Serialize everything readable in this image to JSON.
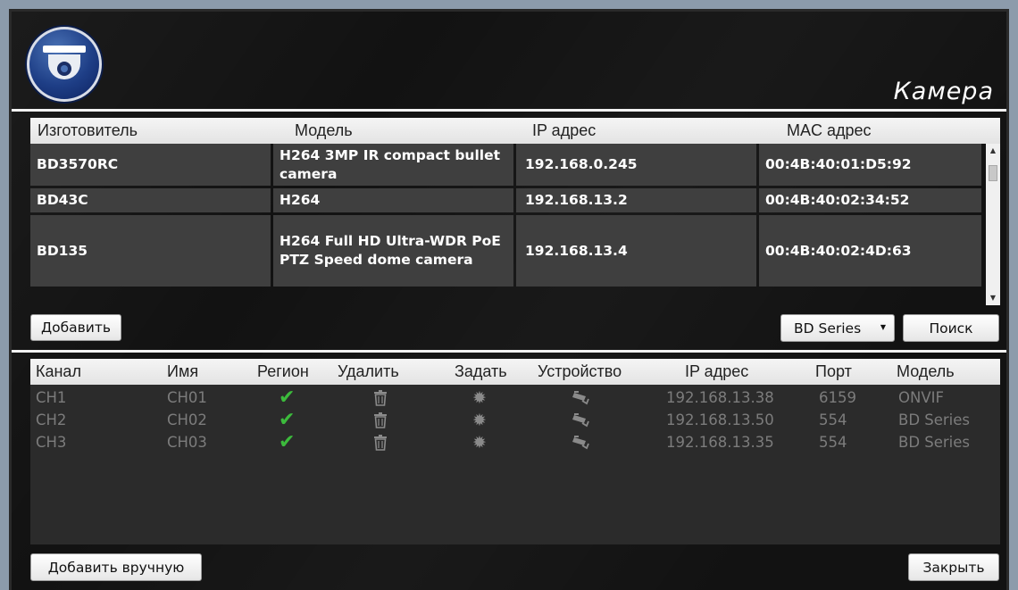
{
  "header": {
    "title": "Камера",
    "logo_icon": "dome-camera-icon"
  },
  "device_table": {
    "columns": [
      "Изготовитель",
      "Модель",
      "IP адрес",
      "MAC адрес"
    ],
    "rows": [
      {
        "vendor": "BD3570RC",
        "model": "H264 3MP IR compact bullet camera",
        "ip": "192.168.0.245",
        "mac": "00:4B:40:01:D5:92"
      },
      {
        "vendor": "BD43C",
        "model": "H264",
        "ip": "192.168.13.2",
        "mac": "00:4B:40:02:34:52"
      },
      {
        "vendor": "BD135",
        "model": "H264 Full HD Ultra-WDR PoE PTZ Speed dome camera",
        "ip": "192.168.13.4",
        "mac": "00:4B:40:02:4D:63"
      }
    ]
  },
  "actions": {
    "add_label": "Добавить",
    "series_select": "BD Series",
    "search_label": "Поиск",
    "add_manual_label": "Добавить вручную",
    "close_label": "Закрыть"
  },
  "channel_table": {
    "columns": [
      "Канал",
      "Имя",
      "Регион",
      "Удалить",
      "Задать",
      "Устройство",
      "IP адрес",
      "Порт",
      "Модель"
    ],
    "rows": [
      {
        "channel": "CH1",
        "name": "CH01",
        "ip": "192.168.13.38",
        "port": "6159",
        "model": "ONVIF"
      },
      {
        "channel": "CH2",
        "name": "CH02",
        "ip": "192.168.13.50",
        "port": "554",
        "model": "BD Series"
      },
      {
        "channel": "CH3",
        "name": "CH03",
        "ip": "192.168.13.35",
        "port": "554",
        "model": "BD Series"
      }
    ],
    "icons": {
      "region": "checkmark-icon",
      "delete": "trash-icon",
      "set": "gear-icon",
      "device": "camera-icon"
    }
  },
  "colors": {
    "background": "#121212",
    "accent_check": "#3cbb3c",
    "row_bg": "#3f3f3f",
    "header_bg": "#ececec",
    "logo_blue": "#1e3e86"
  }
}
